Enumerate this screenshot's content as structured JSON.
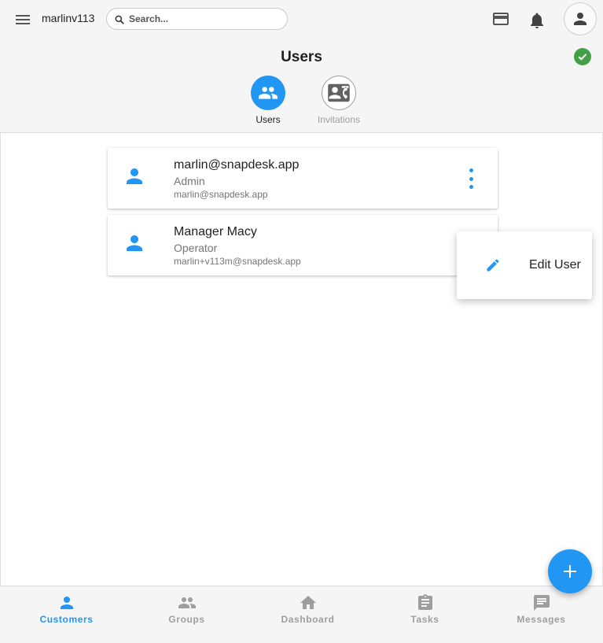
{
  "header": {
    "username": "marlinv113",
    "search_placeholder": "Search...",
    "title": "Users",
    "tabs": [
      {
        "label": "Users",
        "active": true,
        "icon": "people-icon"
      },
      {
        "label": "Invitations",
        "active": false,
        "icon": "contact-mail-icon"
      }
    ],
    "status": "ok"
  },
  "users": [
    {
      "name": "marlin@snapdesk.app",
      "role": "Admin",
      "email": "marlin@snapdesk.app"
    },
    {
      "name": "Manager Macy",
      "role": "Operator",
      "email": "marlin+v113m@snapdesk.app"
    }
  ],
  "context_menu": {
    "items": [
      {
        "label": "Edit User",
        "icon": "pencil-icon"
      }
    ]
  },
  "bottom_nav": {
    "items": [
      {
        "label": "Customers",
        "icon": "person-icon",
        "active": true
      },
      {
        "label": "Groups",
        "icon": "people-icon",
        "active": false
      },
      {
        "label": "Dashboard",
        "icon": "home-icon",
        "active": false
      },
      {
        "label": "Tasks",
        "icon": "clipboard-icon",
        "active": false
      },
      {
        "label": "Messages",
        "icon": "message-icon",
        "active": false
      }
    ]
  },
  "colors": {
    "accent": "#2196f3",
    "inactive": "#9e9e9e",
    "success": "#43a047",
    "header_bg": "#f5f5f5"
  }
}
